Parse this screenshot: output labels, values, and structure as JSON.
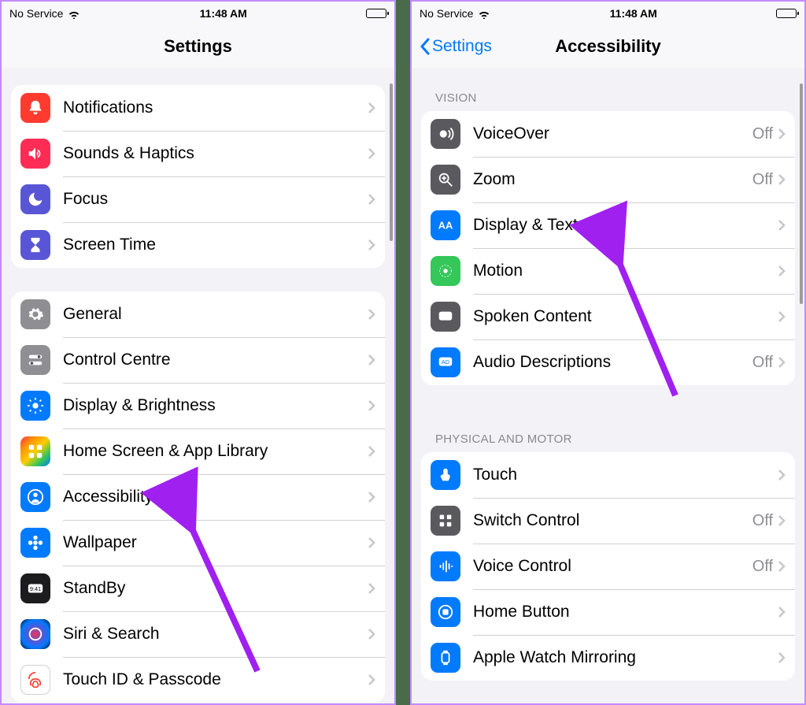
{
  "status": {
    "carrier": "No Service",
    "time": "11:48 AM"
  },
  "left": {
    "title": "Settings",
    "groups": [
      {
        "first": true,
        "rows": [
          {
            "name": "notifications",
            "label": "Notifications",
            "icon": "bell",
            "color": "red"
          },
          {
            "name": "sounds-haptics",
            "label": "Sounds & Haptics",
            "icon": "speaker",
            "color": "pink"
          },
          {
            "name": "focus",
            "label": "Focus",
            "icon": "moon",
            "color": "purple"
          },
          {
            "name": "screen-time",
            "label": "Screen Time",
            "icon": "hourglass",
            "color": "purple"
          }
        ]
      },
      {
        "rows": [
          {
            "name": "general",
            "label": "General",
            "icon": "gear",
            "color": "grey"
          },
          {
            "name": "control-centre",
            "label": "Control Centre",
            "icon": "switches",
            "color": "grey"
          },
          {
            "name": "display-brightness",
            "label": "Display & Brightness",
            "icon": "sun",
            "color": "blue"
          },
          {
            "name": "home-screen",
            "label": "Home Screen & App Library",
            "icon": "grid",
            "color": "multicolor"
          },
          {
            "name": "accessibility",
            "label": "Accessibility",
            "icon": "person",
            "color": "blue"
          },
          {
            "name": "wallpaper",
            "label": "Wallpaper",
            "icon": "flower",
            "color": "blue"
          },
          {
            "name": "standby",
            "label": "StandBy",
            "icon": "clock",
            "color": "black"
          },
          {
            "name": "siri-search",
            "label": "Siri & Search",
            "icon": "siri",
            "color": "siri"
          },
          {
            "name": "touch-id",
            "label": "Touch ID & Passcode",
            "icon": "fingerprint",
            "color": "white"
          }
        ]
      }
    ]
  },
  "right": {
    "back": "Settings",
    "title": "Accessibility",
    "sections": [
      {
        "header": "Vision",
        "rows": [
          {
            "name": "voiceover",
            "label": "VoiceOver",
            "value": "Off",
            "icon": "voiceover",
            "color": "darkgrey"
          },
          {
            "name": "zoom",
            "label": "Zoom",
            "value": "Off",
            "icon": "zoom",
            "color": "darkgrey"
          },
          {
            "name": "display-text-size",
            "label": "Display & Text Size",
            "icon": "aa",
            "color": "blue"
          },
          {
            "name": "motion",
            "label": "Motion",
            "icon": "motion",
            "color": "green"
          },
          {
            "name": "spoken-content",
            "label": "Spoken Content",
            "icon": "speech",
            "color": "darkgrey"
          },
          {
            "name": "audio-descriptions",
            "label": "Audio Descriptions",
            "value": "Off",
            "icon": "ad",
            "color": "blue"
          }
        ]
      },
      {
        "header": "Physical and Motor",
        "rows": [
          {
            "name": "touch",
            "label": "Touch",
            "icon": "touch",
            "color": "blue"
          },
          {
            "name": "switch-control",
            "label": "Switch Control",
            "value": "Off",
            "icon": "switch",
            "color": "darkgrey"
          },
          {
            "name": "voice-control",
            "label": "Voice Control",
            "value": "Off",
            "icon": "voice",
            "color": "blue"
          },
          {
            "name": "home-button",
            "label": "Home Button",
            "icon": "home",
            "color": "blue"
          },
          {
            "name": "apple-watch-mirroring",
            "label": "Apple Watch Mirroring",
            "icon": "watch",
            "color": "blue"
          }
        ]
      }
    ]
  }
}
